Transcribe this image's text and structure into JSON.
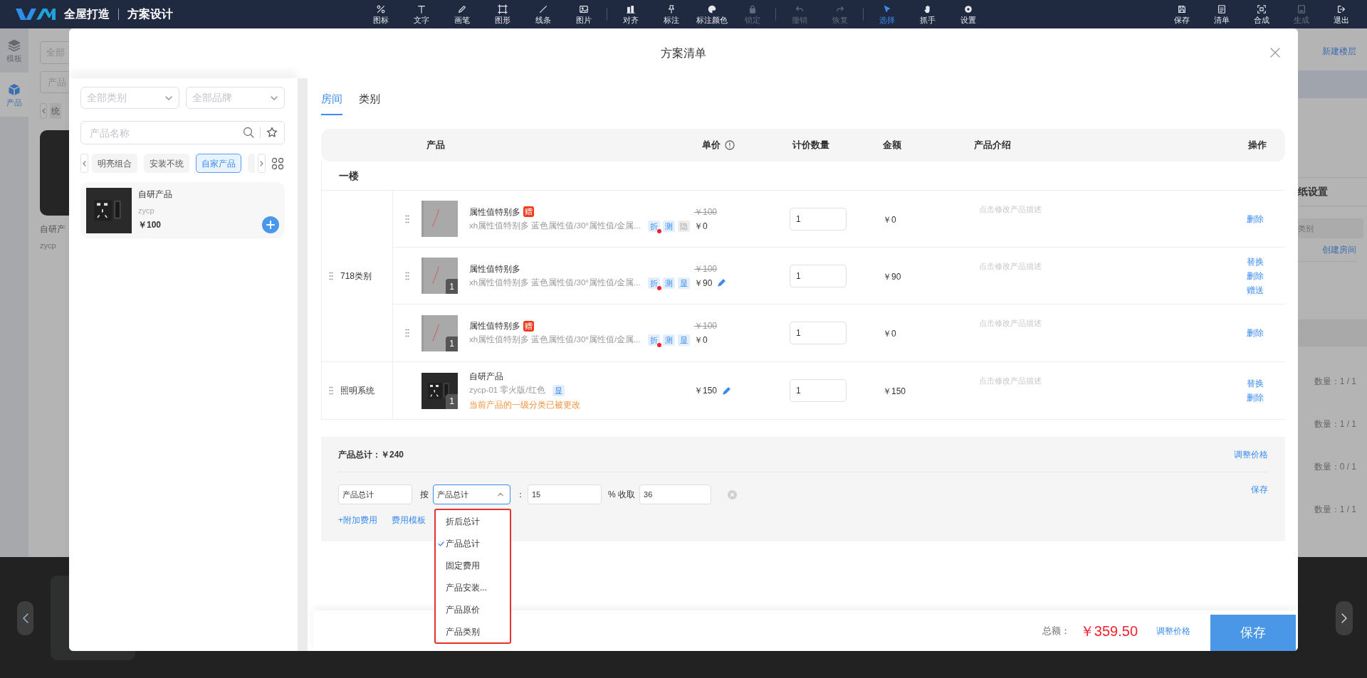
{
  "app_bar": {
    "brand": "全屋打造",
    "section": "方案设计",
    "tool_groups": [
      [
        {
          "label": "图标",
          "disabled": false,
          "selected": false
        },
        {
          "label": "文字",
          "disabled": false,
          "selected": false
        },
        {
          "label": "画笔",
          "disabled": false,
          "selected": false
        },
        {
          "label": "图形",
          "disabled": false,
          "selected": false
        },
        {
          "label": "线条",
          "disabled": false,
          "selected": false
        },
        {
          "label": "图片",
          "disabled": false,
          "selected": false
        }
      ],
      [
        {
          "label": "对齐",
          "disabled": false,
          "selected": false
        },
        {
          "label": "标注",
          "disabled": false,
          "selected": false
        },
        {
          "label": "标注颜色",
          "disabled": false,
          "selected": false
        },
        {
          "label": "锁定",
          "disabled": true,
          "selected": false
        }
      ],
      [
        {
          "label": "撤销",
          "disabled": true,
          "selected": false
        },
        {
          "label": "恢复",
          "disabled": true,
          "selected": false
        }
      ],
      [
        {
          "label": "选择",
          "disabled": false,
          "selected": true
        },
        {
          "label": "抓手",
          "disabled": false,
          "selected": false
        },
        {
          "label": "设置",
          "disabled": false,
          "selected": false
        }
      ]
    ],
    "actions": [
      {
        "label": "保存",
        "disabled": false
      },
      {
        "label": "清单",
        "disabled": false
      },
      {
        "label": "合成",
        "disabled": false
      },
      {
        "label": "生成",
        "disabled": true
      },
      {
        "label": "退出",
        "disabled": false
      }
    ]
  },
  "side_nav": [
    {
      "label": "模板",
      "selected": false
    },
    {
      "label": "产品",
      "selected": true
    }
  ],
  "background_panel": {
    "category_field": "全部",
    "name_field": "产品",
    "tab": "统",
    "card_name": "自研产",
    "card_code": "zycp"
  },
  "background_right": {
    "new_floor": "新建楼层",
    "drawing_settings": "纸设置",
    "category_field": "类别",
    "create_room": "创建房间",
    "counts": [
      "数量：1 / 1",
      "数量：1 / 1",
      "数量：0 / 1",
      "数量：1 / 1"
    ]
  },
  "modal": {
    "title": "方案清单",
    "catalog": {
      "category_select": "全部类别",
      "brand_select": "全部品牌",
      "search_placeholder": "产品名称",
      "chips": [
        {
          "label": "明亮组合",
          "selected": false
        },
        {
          "label": "安装不统",
          "selected": false
        },
        {
          "label": "自家产品",
          "selected": true
        }
      ],
      "products": [
        {
          "name": "自研产品",
          "code": "zycp",
          "price": "￥100"
        }
      ]
    },
    "tabs": [
      {
        "label": "房间",
        "selected": true
      },
      {
        "label": "类别",
        "selected": false
      }
    ],
    "table": {
      "columns": [
        "产品",
        "单价",
        "计价数量",
        "金额",
        "产品介绍",
        "操作"
      ],
      "floors": [
        {
          "name": "一楼",
          "groups": [
            {
              "name": "718类别",
              "items": [
                {
                  "name": "属性值特别多",
                  "gift_badge": "赠",
                  "spec": "xh属性值特别多 蓝色属性值/30°属性值/金属...",
                  "kind": "sketch",
                  "tags": [
                    {
                      "label": "折",
                      "kind": "split"
                    },
                    {
                      "label": "测",
                      "kind": "measure"
                    },
                    {
                      "label": "隐",
                      "kind": "hidden"
                    }
                  ],
                  "original_price": "￥100",
                  "price": "￥0",
                  "price_editable": false,
                  "draggable": true,
                  "quantity": "1",
                  "amount": "￥0",
                  "description": "点击修改产品描述",
                  "actions": [
                    "删除"
                  ]
                },
                {
                  "name": "属性值特别多",
                  "spec": "xh属性值特别多 蓝色属性值/30°属性值/金属...",
                  "kind": "sketch",
                  "image_count": "1",
                  "tags": [
                    {
                      "label": "折",
                      "kind": "split"
                    },
                    {
                      "label": "测",
                      "kind": "measure"
                    },
                    {
                      "label": "显",
                      "kind": "shown"
                    }
                  ],
                  "original_price": "￥100",
                  "price": "￥90",
                  "price_editable": true,
                  "draggable": true,
                  "quantity": "1",
                  "amount": "￥90",
                  "description": "点击修改产品描述",
                  "actions": [
                    "替换",
                    "删除",
                    "赠送"
                  ]
                },
                {
                  "name": "属性值特别多",
                  "gift_badge": "赠",
                  "spec": "xh属性值特别多 蓝色属性值/30°属性值/金属...",
                  "kind": "sketch",
                  "image_count": "1",
                  "tags": [
                    {
                      "label": "折",
                      "kind": "split"
                    },
                    {
                      "label": "测",
                      "kind": "measure"
                    },
                    {
                      "label": "显",
                      "kind": "shown"
                    }
                  ],
                  "original_price": "￥100",
                  "price": "￥0",
                  "price_editable": false,
                  "draggable": true,
                  "quantity": "1",
                  "amount": "￥0",
                  "description": "点击修改产品描述",
                  "actions": [
                    "删除"
                  ]
                }
              ]
            },
            {
              "name": "照明系统",
              "items": [
                {
                  "name": "自研产品",
                  "spec": "zycp-01 零火版/红色",
                  "kind": "socket",
                  "image_count": "1",
                  "tags": [
                    {
                      "label": "显",
                      "kind": "shown"
                    }
                  ],
                  "price": "￥150",
                  "price_editable": true,
                  "draggable": false,
                  "warning": "当前产品的一级分类已被更改",
                  "quantity": "1",
                  "amount": "￥150",
                  "description": "点击修改产品描述",
                  "actions": [
                    "替换",
                    "删除"
                  ]
                }
              ]
            }
          ]
        }
      ]
    },
    "summary": {
      "subtotal": "产品总计：￥240",
      "adjust_link": "调整价格",
      "fee": {
        "name": "产品总计",
        "by_label": "按",
        "basis": "产品总计",
        "colon": "：",
        "rate": "15",
        "percent_label": "% 收取",
        "amount": "36",
        "save": "保存",
        "options": [
          {
            "label": "折后总计",
            "selected": false
          },
          {
            "label": "产品总计",
            "selected": true
          },
          {
            "label": "固定费用",
            "selected": false
          },
          {
            "label": "产品安装...",
            "selected": false
          },
          {
            "label": "产品原价",
            "selected": false
          },
          {
            "label": "产品类别",
            "selected": false
          }
        ]
      },
      "add_fee": "+附加费用",
      "fee_template": "费用模板"
    },
    "footer": {
      "total_label": "总额：",
      "total": "￥359.50",
      "adjust_link": "调整价格",
      "save": "保存"
    }
  }
}
